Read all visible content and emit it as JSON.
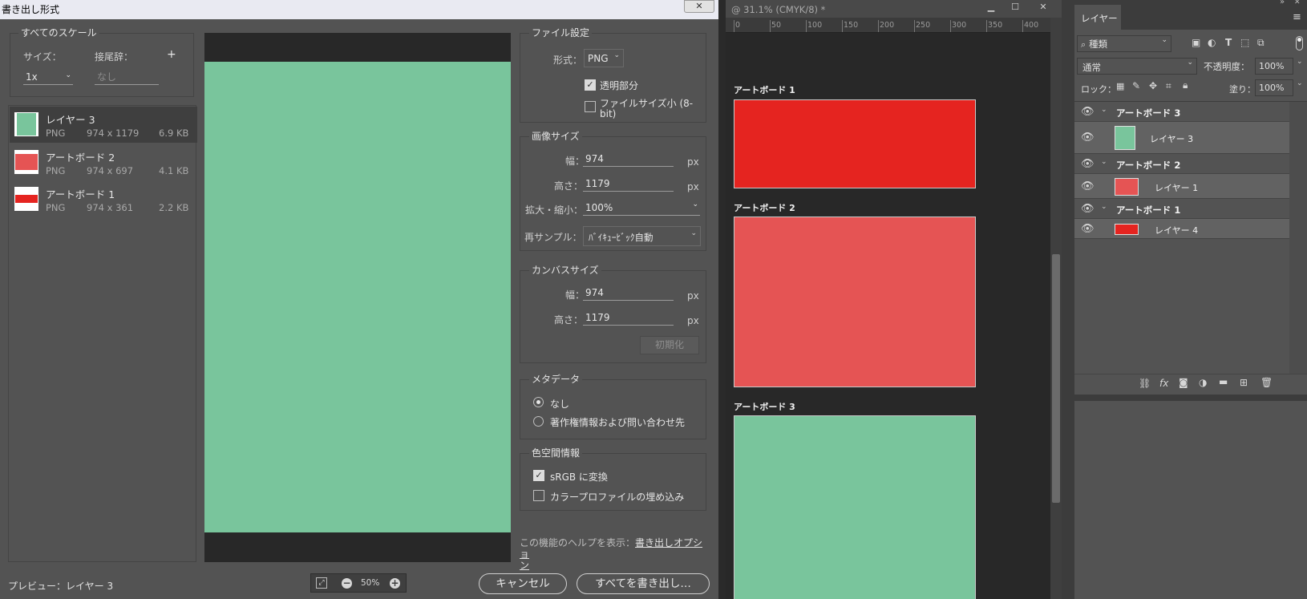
{
  "dialog": {
    "title": "書き出し形式",
    "close_glyph": "✕",
    "scales": {
      "title": "すべてのスケール",
      "size_label": "サイズ：",
      "suffix_label": "接尾辞：",
      "add_glyph": "+",
      "size_value": "1x",
      "suffix_placeholder": "なし"
    },
    "assets": [
      {
        "name": "レイヤー 3",
        "format": "PNG",
        "dims": "974 x 1179",
        "filesize": "6.9 KB",
        "color": "#79c59c"
      },
      {
        "name": "アートボード 2",
        "format": "PNG",
        "dims": "974 x 697",
        "filesize": "4.1 KB",
        "color": "#e55454"
      },
      {
        "name": "アートボード 1",
        "format": "PNG",
        "dims": "974 x 361",
        "filesize": "2.2 KB",
        "color": "#e52420"
      }
    ],
    "preview_color": "#79c59c",
    "file_settings": {
      "title": "ファイル設定",
      "format_label": "形式：",
      "format_value": "PNG",
      "transparency_label": "透明部分",
      "transparency_checked": true,
      "smaller_file_label_1": "ファイルサイズ小 (8-",
      "smaller_file_label_2": "bit)",
      "smaller_file_checked": false
    },
    "image_size": {
      "title": "画像サイズ",
      "width_label": "幅：",
      "width_value": "974",
      "height_label": "高さ：",
      "height_value": "1179",
      "scale_label": "拡大・縮小：",
      "scale_value": "100%",
      "resample_label": "再サンプル：",
      "resample_value": "ﾊﾞｲｷｭｰﾋﾞｯｸ自動",
      "unit": "px"
    },
    "canvas_size": {
      "title": "カンバスサイズ",
      "width_label": "幅：",
      "width_value": "974",
      "height_label": "高さ：",
      "height_value": "1179",
      "unit": "px",
      "reset_label": "初期化"
    },
    "metadata": {
      "title": "メタデータ",
      "option_none": "なし",
      "option_copyright": "著作権情報および問い合わせ先",
      "selected": "なし"
    },
    "color_space": {
      "title": "色空間情報",
      "srgb_label": "sRGB に変換",
      "srgb_checked": true,
      "embed_label": "カラープロファイルの埋め込み",
      "embed_checked": false
    },
    "help": {
      "prefix": "この機能のヘルプを表示：",
      "link_1": "書き出しオプショ",
      "link_2": "ン"
    },
    "footer": {
      "preview_label": "プレビュー：レイヤー 3",
      "zoom_value": "50%",
      "cancel_label": "キャンセル",
      "export_label": "すべてを書き出し…"
    }
  },
  "canvas_window": {
    "title": "@ 31.1% (CMYK/8) *",
    "min_glyph": "▁",
    "max_glyph": "☐",
    "close_glyph": "✕",
    "ruler_ticks": [
      "0",
      "50",
      "100",
      "150",
      "200",
      "250",
      "300",
      "350",
      "400"
    ],
    "artboards": [
      {
        "label": "アートボード 1",
        "color": "#e52420"
      },
      {
        "label": "アートボード 2",
        "color": "#e55454"
      },
      {
        "label": "アートボード 3",
        "color": "#79c59c"
      }
    ]
  },
  "layers_panel": {
    "tab_label": "レイヤー",
    "collapse_glyph": "»",
    "close_glyph": "✕",
    "menu_glyph": "≡",
    "filter_kind": "種類",
    "blend_mode": "通常",
    "opacity_label": "不透明度：",
    "opacity_value": "100%",
    "lock_label": "ロック：",
    "fill_label": "塗り：",
    "fill_value": "100%",
    "rows": [
      {
        "name": "アートボード 3",
        "type": "artboard"
      },
      {
        "name": "レイヤー 3",
        "type": "layer",
        "color": "#79c59c"
      },
      {
        "name": "アートボード 2",
        "type": "artboard"
      },
      {
        "name": "レイヤー 1",
        "type": "layer",
        "color": "#e55454"
      },
      {
        "name": "アートボード 1",
        "type": "artboard"
      },
      {
        "name": "レイヤー 4",
        "type": "layer",
        "color": "#e52420"
      }
    ],
    "bottom_icons": [
      "link-icon",
      "fx-icon",
      "mask-icon",
      "adjustment-icon",
      "folder-icon",
      "new-layer-icon",
      "trash-icon"
    ]
  }
}
